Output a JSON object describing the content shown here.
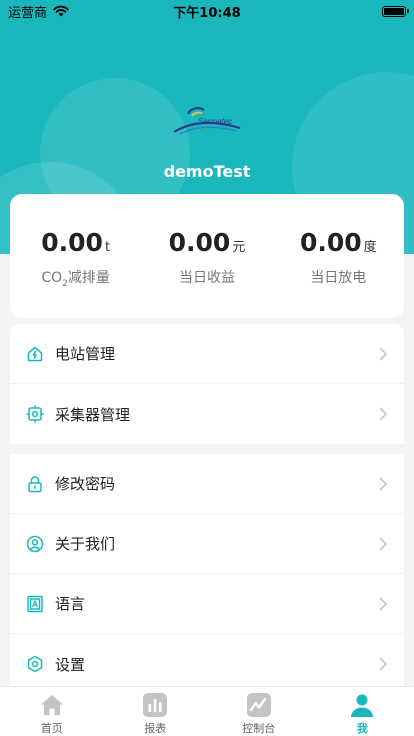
{
  "status_bar": {
    "carrier": "运营商",
    "time": "下午10:48"
  },
  "profile": {
    "username": "demoTest",
    "logo_text": "Sermatec"
  },
  "stats": [
    {
      "value": "0.00",
      "unit": "t",
      "label_prefix": "CO",
      "label_sub": "2",
      "label_suffix": "减排量"
    },
    {
      "value": "0.00",
      "unit": "元",
      "label": "当日收益"
    },
    {
      "value": "0.00",
      "unit": "度",
      "label": "当日放电"
    }
  ],
  "menu": {
    "group1": [
      {
        "label": "电站管理",
        "icon": "home-bolt-icon"
      },
      {
        "label": "采集器管理",
        "icon": "chip-icon"
      }
    ],
    "group2": [
      {
        "label": "修改密码",
        "icon": "lock-icon"
      },
      {
        "label": "关于我们",
        "icon": "user-circle-icon"
      },
      {
        "label": "语言",
        "icon": "language-icon"
      },
      {
        "label": "设置",
        "icon": "settings-hex-icon"
      }
    ]
  },
  "tabs": [
    {
      "label": "首页",
      "icon": "home-icon"
    },
    {
      "label": "报表",
      "icon": "bar-chart-icon"
    },
    {
      "label": "控制台",
      "icon": "console-icon"
    },
    {
      "label": "我",
      "icon": "person-icon",
      "active": true
    }
  ],
  "colors": {
    "accent": "#1ab8bd",
    "icon_gray": "#c4c4c4"
  }
}
